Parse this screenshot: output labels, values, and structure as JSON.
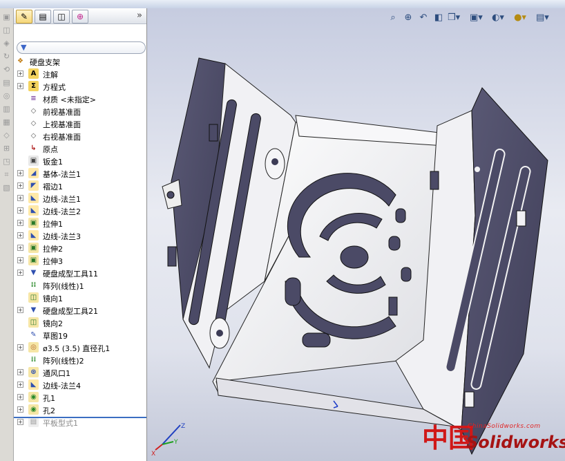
{
  "feature_tree": {
    "root_label": "硬盘支架",
    "items": [
      {
        "label": "注解",
        "icon": "annotation-icon",
        "expandable": true
      },
      {
        "label": "方程式",
        "icon": "equation-icon",
        "expandable": true
      },
      {
        "label": "材质 <未指定>",
        "icon": "material-icon",
        "expandable": false
      },
      {
        "label": "前视基准面",
        "icon": "plane-icon",
        "expandable": false
      },
      {
        "label": "上视基准面",
        "icon": "plane-icon",
        "expandable": false
      },
      {
        "label": "右视基准面",
        "icon": "plane-icon",
        "expandable": false
      },
      {
        "label": "原点",
        "icon": "origin-icon",
        "expandable": false
      },
      {
        "label": "钣金1",
        "icon": "sheetmetal-icon",
        "expandable": false
      },
      {
        "label": "基体-法兰1",
        "icon": "base-flange-icon",
        "expandable": true
      },
      {
        "label": "褶边1",
        "icon": "hem-icon",
        "expandable": true
      },
      {
        "label": "边线-法兰1",
        "icon": "edge-flange-icon",
        "expandable": true
      },
      {
        "label": "边线-法兰2",
        "icon": "edge-flange-icon",
        "expandable": true
      },
      {
        "label": "拉伸1",
        "icon": "extrude-cut-icon",
        "expandable": true
      },
      {
        "label": "边线-法兰3",
        "icon": "edge-flange-icon",
        "expandable": true
      },
      {
        "label": "拉伸2",
        "icon": "extrude-cut-icon",
        "expandable": true
      },
      {
        "label": "拉伸3",
        "icon": "extrude-cut-icon",
        "expandable": true
      },
      {
        "label": "硬盘成型工具11",
        "icon": "forming-tool-icon",
        "expandable": true
      },
      {
        "label": "阵列(线性)1",
        "icon": "linear-pattern-icon",
        "expandable": false
      },
      {
        "label": "镜向1",
        "icon": "mirror-icon",
        "expandable": false
      },
      {
        "label": "硬盘成型工具21",
        "icon": "forming-tool-icon",
        "expandable": true
      },
      {
        "label": "镜向2",
        "icon": "mirror-icon",
        "expandable": false
      },
      {
        "label": "草图19",
        "icon": "sketch-icon",
        "expandable": false
      },
      {
        "label": "ø3.5 (3.5) 直径孔1",
        "icon": "hole-wizard-icon",
        "expandable": true
      },
      {
        "label": "阵列(线性)2",
        "icon": "linear-pattern-icon",
        "expandable": false
      },
      {
        "label": "通风口1",
        "icon": "vent-icon",
        "expandable": true
      },
      {
        "label": "边线-法兰4",
        "icon": "edge-flange-icon",
        "expandable": true
      },
      {
        "label": "孔1",
        "icon": "hole-icon",
        "expandable": true
      },
      {
        "label": "孔2",
        "icon": "hole-icon",
        "expandable": true
      },
      {
        "label": "平板型式1",
        "icon": "flat-pattern-icon",
        "expandable": true,
        "suppressed": true
      }
    ]
  },
  "panel_tabs": [
    "feature-manager",
    "property-manager",
    "configuration-manager",
    "dimxpert-manager"
  ],
  "headsup_toolbar": [
    "zoom-to-fit-icon",
    "zoom-area-icon",
    "previous-view-icon",
    "section-view-icon",
    "view-orientation-icon",
    "display-style-icon",
    "hide-show-icon",
    "appearance-icon",
    "scene-icon"
  ],
  "triad": {
    "x": "X",
    "y": "Y",
    "z": "Z"
  },
  "watermark": {
    "url": "ChinaSolidworks.com",
    "cn": "中国",
    "brand": "Solidworks"
  },
  "colors": {
    "accent": "#3b6ec2",
    "part_light": "#f2f2f4",
    "part_dark": "#4a4a66",
    "watermark": "#d01818"
  }
}
